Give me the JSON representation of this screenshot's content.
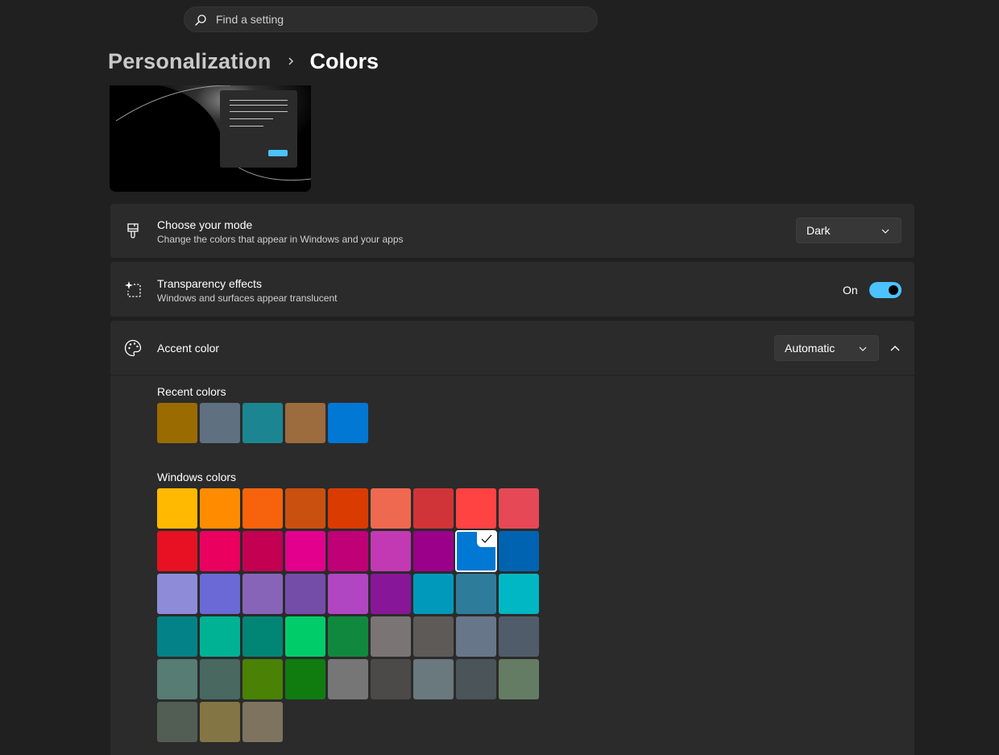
{
  "search": {
    "placeholder": "Find a setting"
  },
  "breadcrumb": {
    "parent": "Personalization",
    "current": "Colors"
  },
  "mode": {
    "title": "Choose your mode",
    "description": "Change the colors that appear in Windows and your apps",
    "value": "Dark"
  },
  "transparency": {
    "title": "Transparency effects",
    "description": "Windows and surfaces appear translucent",
    "state_label": "On",
    "enabled": true
  },
  "accent": {
    "title": "Accent color",
    "value": "Automatic",
    "expanded": true
  },
  "recent_colors": {
    "label": "Recent colors",
    "colors": [
      "#9a6b00",
      "#5f7080",
      "#1b8691",
      "#9c6b3e",
      "#0078d4"
    ]
  },
  "windows_colors": {
    "label": "Windows colors",
    "selected_index": 16,
    "colors": [
      "#ffb900",
      "#ff8c00",
      "#f7630c",
      "#ca5010",
      "#da3b01",
      "#ef6950",
      "#d13438",
      "#ff4343",
      "#e74856",
      "#e81123",
      "#ea005e",
      "#c30052",
      "#e3008c",
      "#bf0077",
      "#c239b3",
      "#9a0089",
      "#0078d4",
      "#0063b1",
      "#8e8cd8",
      "#6b69d6",
      "#8764b8",
      "#744da9",
      "#b146c2",
      "#881798",
      "#0099bc",
      "#2d7d9a",
      "#00b7c3",
      "#038387",
      "#00b294",
      "#018574",
      "#00cc6a",
      "#10893e",
      "#7a7574",
      "#5d5a58",
      "#68768a",
      "#515c6b",
      "#567c73",
      "#486860",
      "#498205",
      "#107c10",
      "#767676",
      "#4c4a48",
      "#69797e",
      "#4a5459",
      "#647c64",
      "#525e54",
      "#847545",
      "#7e735f"
    ]
  },
  "icons": {
    "search": "search-icon",
    "mode": "paintbrush-icon",
    "transparency": "sparkle-frame-icon",
    "accent": "palette-icon",
    "chevron_down": "chevron-down-icon",
    "chevron_up": "chevron-up-icon",
    "check": "checkmark-icon"
  }
}
